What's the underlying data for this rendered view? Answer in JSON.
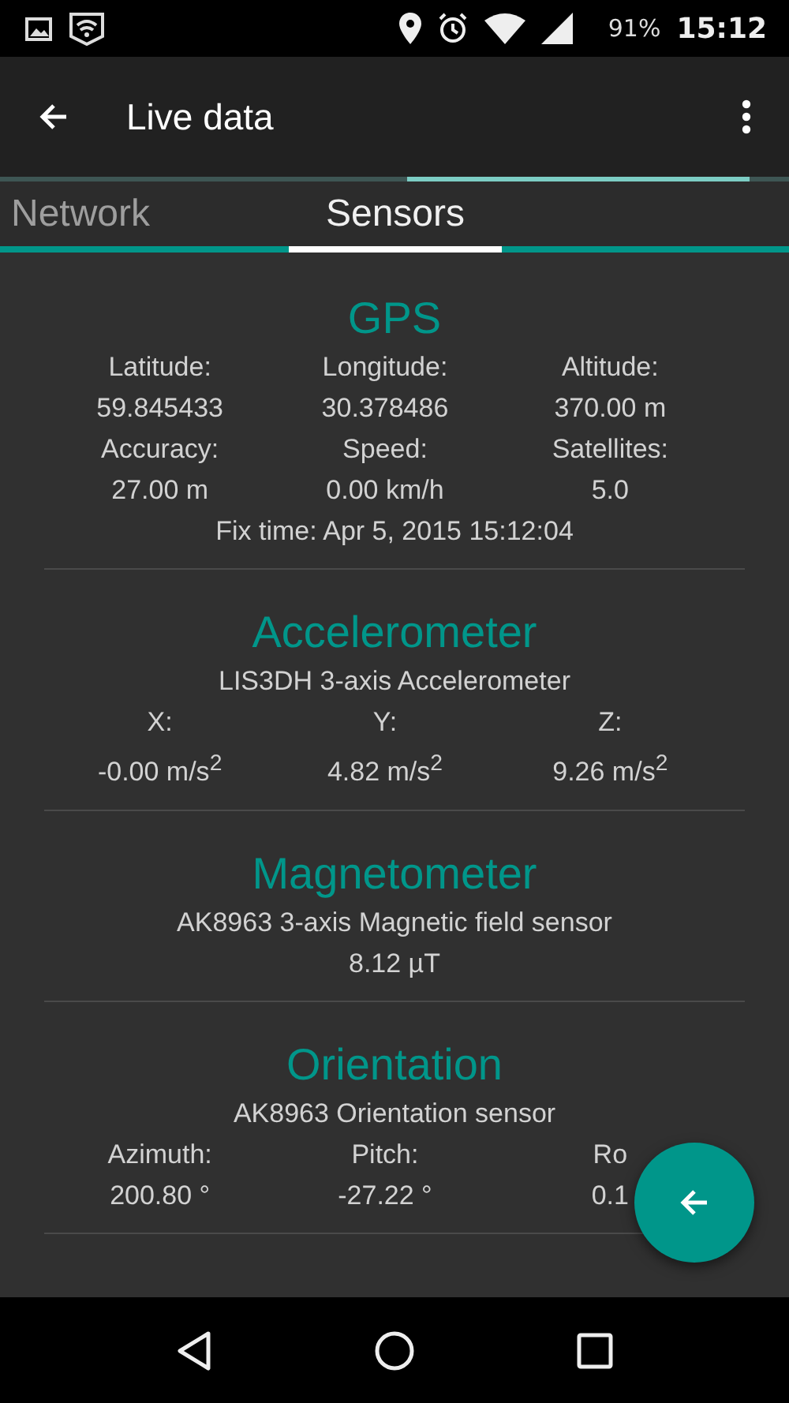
{
  "status_bar": {
    "battery": "91%",
    "time": "15:12"
  },
  "app_bar": {
    "title": "Live data"
  },
  "tabs": [
    {
      "label": "Network",
      "selected": false
    },
    {
      "label": "Sensors",
      "selected": true
    }
  ],
  "sections": [
    {
      "title": "GPS",
      "fields": [
        {
          "label": "Latitude:",
          "value": "59.845433"
        },
        {
          "label": "Longitude:",
          "value": "30.378486"
        },
        {
          "label": "Altitude:",
          "value": "370.00 m"
        },
        {
          "label": "Accuracy:",
          "value": "27.00 m"
        },
        {
          "label": "Speed:",
          "value": "0.00 km/h"
        },
        {
          "label": "Satellites:",
          "value": "5.0"
        }
      ],
      "lines": [
        "Fix time: Apr 5, 2015 15:12:04"
      ]
    },
    {
      "title": "Accelerometer",
      "subtitle": "LIS3DH 3-axis Accelerometer",
      "fields": [
        {
          "label": "X:",
          "value": "-0.00 m/s$^{2}$"
        },
        {
          "label": "Y:",
          "value": "4.82 m/s$^{2}$"
        },
        {
          "label": "Z:",
          "value": "9.26 m/s$^{2}$"
        }
      ]
    },
    {
      "title": "Magnetometer",
      "subtitle": "AK8963 3-axis Magnetic field sensor",
      "lines": [
        "8.12 µT"
      ]
    },
    {
      "title": "Orientation",
      "subtitle": "AK8963 Orientation sensor",
      "fields": [
        {
          "label": "Azimuth:",
          "value": "200.80 °"
        },
        {
          "label": "Pitch:",
          "value": "-27.22 °"
        },
        {
          "label": "Ro",
          "value": "0.1"
        }
      ]
    }
  ]
}
